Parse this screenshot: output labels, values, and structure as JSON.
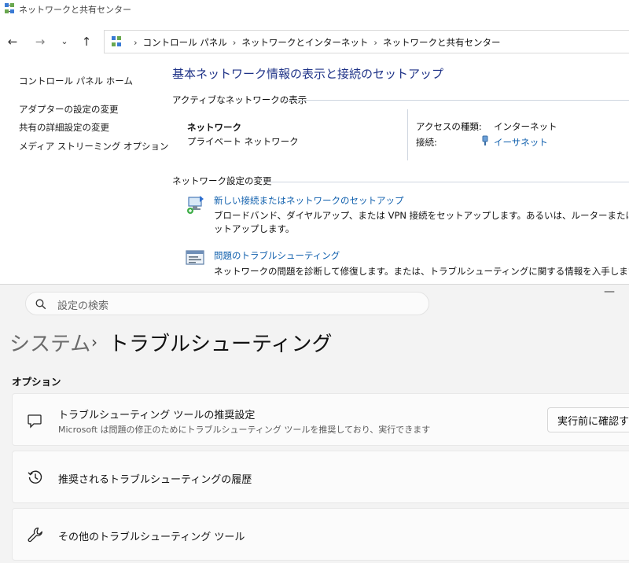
{
  "control_panel": {
    "window_title": "ネットワークと共有センター",
    "breadcrumb": [
      "コントロール パネル",
      "ネットワークとインターネット",
      "ネットワークと共有センター"
    ],
    "sidebar": {
      "home": "コントロール パネル ホーム",
      "items": [
        "アダプターの設定の変更",
        "共有の詳細設定の変更",
        "メディア ストリーミング オプション"
      ]
    },
    "heading": "基本ネットワーク情報の表示と接続のセットアップ",
    "active_networks_label": "アクティブなネットワークの表示",
    "network": {
      "name": "ネットワーク",
      "type": "プライベート ネットワーク",
      "access_type_label": "アクセスの種類:",
      "access_type_value": "インターネット",
      "connection_label": "接続:",
      "connection_value": "イーサネット"
    },
    "change_settings_label": "ネットワーク設定の変更",
    "tasks": [
      {
        "title": "新しい接続またはネットワークのセットアップ",
        "desc_line1": "ブロードバンド、ダイヤルアップ、または VPN 接続をセットアップします。あるいは、ルーターまたはアクセス ポイントをセ",
        "desc_line2": "ットアップします。"
      },
      {
        "title": "問題のトラブルシューティング",
        "desc_line1": "ネットワークの問題を診断して修復します。または、トラブルシューティングに関する情報を入手します。"
      }
    ]
  },
  "settings": {
    "search_placeholder": "設定の検索",
    "breadcrumb_parent": "システム",
    "breadcrumb_sep": "›",
    "breadcrumb_current": "トラブルシューティング",
    "section_label": "オプション",
    "cards": [
      {
        "title": "トラブルシューティング ツールの推奨設定",
        "subtitle": "Microsoft は問題の修正のためにトラブルシューティング ツールを推奨しており、実行できます",
        "button": "実行前に確認する",
        "icon": "chat-bubble-icon"
      },
      {
        "title": "推奨されるトラブルシューティングの履歴",
        "icon": "history-icon"
      },
      {
        "title": "その他のトラブルシューティング ツール",
        "icon": "wrench-icon"
      }
    ]
  },
  "colors": {
    "heading_blue": "#1e3287",
    "link_blue": "#0f5fad"
  }
}
